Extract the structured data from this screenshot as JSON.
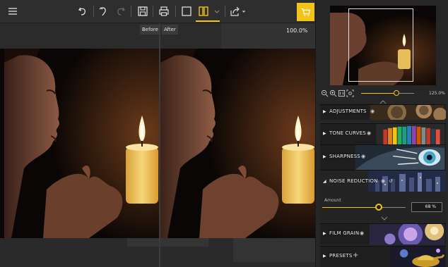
{
  "toolbar": {
    "icons": [
      "hamburger-menu-icon",
      "undo-icon",
      "redo-icon",
      "redo-disabled-icon",
      "save-icon",
      "print-icon",
      "single-view-icon",
      "split-view-icon",
      "view-dropdown-icon",
      "share-icon",
      "cart-icon"
    ],
    "accent": "#f0c419"
  },
  "view": {
    "before_label": "Before",
    "after_label": "After",
    "zoom_readout": "100.0%"
  },
  "navigator": {
    "zoom_percent": "125.0%",
    "zoom_slider_level": 0.66
  },
  "sections": [
    {
      "key": "adjustments",
      "title": "ADJUSTMENTS",
      "expanded": false
    },
    {
      "key": "tone_curves",
      "title": "TONE CURVES",
      "expanded": false
    },
    {
      "key": "sharpness",
      "title": "SHARPNESS",
      "expanded": false
    },
    {
      "key": "noise_reduction",
      "title": "NOISE REDUCTION",
      "expanded": true
    },
    {
      "key": "film_grain",
      "title": "FILM GRAIN",
      "expanded": false
    },
    {
      "key": "presets",
      "title": "PRESETS",
      "expanded": false
    }
  ],
  "noise_reduction": {
    "amount_label": "Amount",
    "amount_value": "68 %",
    "amount_level": 0.68
  }
}
